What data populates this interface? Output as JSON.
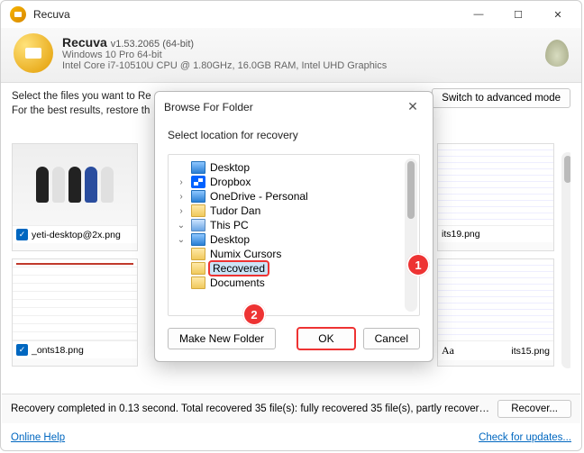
{
  "app": {
    "title": "Recuva",
    "header_title": "Recuva",
    "version": "v1.53.2065 (64-bit)",
    "os": "Windows 10 Pro 64-bit",
    "hw": "Intel Core i7-10510U CPU @ 1.80GHz, 16.0GB RAM, Intel UHD Graphics"
  },
  "main": {
    "instr1": "Select the files you want to Re",
    "instr2": "For the best results, restore th",
    "switch_mode": "Switch to advanced mode"
  },
  "thumbs": {
    "a_name": "yeti-desktop@2x.png",
    "b_name": "_onts18.png",
    "c_name": "its19.png",
    "d_name": "its15.png"
  },
  "status": {
    "text": "Recovery completed in 0.13 second. Total recovered 35 file(s): fully recovered 35 file(s), partly recover…",
    "recover": "Recover..."
  },
  "footer": {
    "help": "Online Help",
    "updates": "Check for updates..."
  },
  "dialog": {
    "title": "Browse For Folder",
    "prompt": "Select location for recovery",
    "make_new": "Make New Folder",
    "ok": "OK",
    "cancel": "Cancel",
    "tree": {
      "desktop": "Desktop",
      "dropbox": "Dropbox",
      "onedrive": "OneDrive - Personal",
      "tudor": "Tudor Dan",
      "thispc": "This PC",
      "desktop2": "Desktop",
      "numix": "Numix Cursors",
      "recovered": "Recovered",
      "documents": "Documents"
    }
  },
  "badges": {
    "b1": "1",
    "b2": "2"
  }
}
